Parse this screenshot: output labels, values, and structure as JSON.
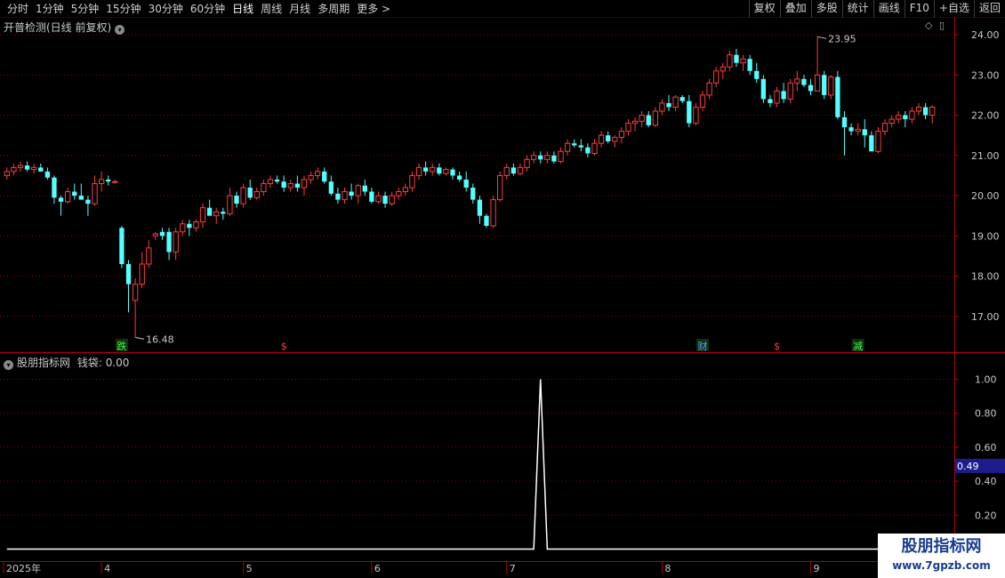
{
  "toolbar": {
    "periods": [
      "分时",
      "1分钟",
      "5分钟",
      "15分钟",
      "30分钟",
      "60分钟",
      "日线",
      "周线",
      "月线",
      "多周期",
      "更多 >"
    ],
    "active_period": "日线",
    "right_buttons": [
      "复权",
      "叠加",
      "多股",
      "统计",
      "画线",
      "F10",
      "+自选",
      "返回"
    ]
  },
  "main_pane": {
    "title": "开普检测(日线 前复权)"
  },
  "indicator_pane": {
    "title": "股朋指标网",
    "series_label": "钱袋: 0.00",
    "cursor_value": "0.49"
  },
  "watermark": {
    "line1": "股朋指标网",
    "line2": "www.7gpzb.com"
  },
  "colors": {
    "up": "#ff3c3c",
    "down": "#54ffff",
    "grid": "#8b0000",
    "axis": "#b00000",
    "bg": "#000000",
    "line": "#ffffff",
    "highlight_box": "#1c1c8c"
  },
  "chart_data": [
    {
      "type": "candlestick",
      "y_ticks": [
        "24.00",
        "23.00",
        "22.00",
        "21.00",
        "20.00",
        "19.00",
        "18.00",
        "17.00"
      ],
      "ylim": [
        16.2,
        24.2
      ],
      "annotations": [
        {
          "text": "23.95",
          "value": 23.95
        },
        {
          "text": "16.48",
          "value": 16.48
        }
      ],
      "markers": [
        {
          "text": "跌",
          "color": "#3cff3c",
          "x_index": 17
        },
        {
          "text": "$",
          "color": "#ff3c3c",
          "x_index": 41
        },
        {
          "text": "财",
          "color": "#4ca0ff",
          "x_index": 103
        },
        {
          "text": "$",
          "color": "#ff3c3c",
          "x_index": 114
        },
        {
          "text": "减",
          "color": "#3cff3c",
          "x_index": 126
        }
      ],
      "x_labels": [
        {
          "text": "2025年",
          "index": 0
        },
        {
          "text": "4",
          "index": 14
        },
        {
          "text": "5",
          "index": 35
        },
        {
          "text": "6",
          "index": 54
        },
        {
          "text": "7",
          "index": 74
        },
        {
          "text": "8",
          "index": 97
        },
        {
          "text": "9",
          "index": 119
        }
      ],
      "ohlc": [
        [
          20.5,
          20.7,
          20.4,
          20.6
        ],
        [
          20.6,
          20.8,
          20.5,
          20.7
        ],
        [
          20.7,
          20.85,
          20.6,
          20.75
        ],
        [
          20.75,
          20.85,
          20.6,
          20.65
        ],
        [
          20.65,
          20.8,
          20.55,
          20.7
        ],
        [
          20.7,
          20.8,
          20.6,
          20.6
        ],
        [
          20.6,
          20.7,
          20.4,
          20.45
        ],
        [
          20.45,
          20.5,
          19.8,
          19.95
        ],
        [
          19.95,
          20.0,
          19.5,
          19.85
        ],
        [
          19.85,
          20.2,
          19.8,
          20.1
        ],
        [
          20.1,
          20.3,
          19.9,
          20.0
        ],
        [
          20.0,
          20.3,
          19.9,
          19.9
        ],
        [
          19.9,
          20.0,
          19.5,
          19.8
        ],
        [
          19.8,
          20.5,
          19.75,
          20.3
        ],
        [
          20.3,
          20.6,
          20.1,
          20.4
        ],
        [
          20.4,
          20.5,
          20.25,
          20.35
        ],
        [
          20.35,
          20.4,
          20.3,
          20.35
        ],
        [
          19.2,
          19.25,
          18.2,
          18.3
        ],
        [
          18.3,
          18.4,
          17.1,
          17.8
        ],
        [
          17.4,
          17.95,
          16.48,
          17.8
        ],
        [
          17.8,
          18.6,
          17.7,
          18.3
        ],
        [
          18.3,
          18.9,
          18.2,
          18.7
        ],
        [
          19.0,
          19.1,
          18.9,
          19.05
        ],
        [
          19.1,
          19.2,
          18.9,
          19.0
        ],
        [
          19.1,
          19.2,
          18.4,
          18.6
        ],
        [
          18.6,
          19.2,
          18.4,
          19.1
        ],
        [
          19.1,
          19.4,
          19.0,
          19.3
        ],
        [
          19.3,
          19.4,
          19.0,
          19.2
        ],
        [
          19.2,
          19.4,
          19.1,
          19.35
        ],
        [
          19.35,
          19.8,
          19.2,
          19.7
        ],
        [
          19.7,
          19.9,
          19.6,
          19.5
        ],
        [
          19.5,
          19.7,
          19.3,
          19.6
        ],
        [
          19.6,
          19.7,
          19.4,
          19.55
        ],
        [
          19.55,
          20.2,
          19.5,
          20.0
        ],
        [
          20.0,
          20.1,
          19.7,
          19.8
        ],
        [
          19.8,
          20.3,
          19.7,
          20.2
        ],
        [
          20.2,
          20.4,
          19.9,
          19.95
        ],
        [
          19.95,
          20.2,
          19.9,
          20.1
        ],
        [
          20.1,
          20.4,
          20.0,
          20.3
        ],
        [
          20.3,
          20.5,
          20.2,
          20.4
        ],
        [
          20.4,
          20.5,
          20.3,
          20.35
        ],
        [
          20.35,
          20.5,
          20.1,
          20.2
        ],
        [
          20.2,
          20.4,
          20.1,
          20.3
        ],
        [
          20.3,
          20.5,
          20.1,
          20.2
        ],
        [
          20.2,
          20.5,
          20.0,
          20.4
        ],
        [
          20.4,
          20.6,
          20.3,
          20.5
        ],
        [
          20.5,
          20.7,
          20.4,
          20.6
        ],
        [
          20.6,
          20.7,
          20.3,
          20.35
        ],
        [
          20.35,
          20.5,
          20.0,
          20.05
        ],
        [
          20.05,
          20.2,
          19.8,
          19.9
        ],
        [
          19.9,
          20.2,
          19.8,
          20.1
        ],
        [
          20.1,
          20.3,
          19.9,
          20.0
        ],
        [
          20.0,
          20.3,
          19.8,
          20.25
        ],
        [
          20.25,
          20.4,
          20.0,
          20.1
        ],
        [
          20.1,
          20.2,
          19.8,
          19.85
        ],
        [
          19.85,
          20.1,
          19.8,
          20.0
        ],
        [
          20.0,
          20.1,
          19.7,
          19.8
        ],
        [
          19.8,
          20.1,
          19.75,
          20.0
        ],
        [
          20.0,
          20.2,
          19.9,
          20.1
        ],
        [
          20.1,
          20.3,
          20.0,
          20.2
        ],
        [
          20.2,
          20.6,
          20.1,
          20.5
        ],
        [
          20.5,
          20.8,
          20.4,
          20.7
        ],
        [
          20.7,
          20.85,
          20.5,
          20.6
        ],
        [
          20.6,
          20.8,
          20.5,
          20.7
        ],
        [
          20.7,
          20.8,
          20.5,
          20.55
        ],
        [
          20.55,
          20.7,
          20.5,
          20.65
        ],
        [
          20.65,
          20.7,
          20.4,
          20.5
        ],
        [
          20.5,
          20.6,
          20.35,
          20.4
        ],
        [
          20.4,
          20.6,
          20.1,
          20.2
        ],
        [
          20.2,
          20.3,
          19.8,
          19.9
        ],
        [
          19.9,
          20.0,
          19.3,
          19.5
        ],
        [
          19.5,
          19.55,
          19.2,
          19.25
        ],
        [
          19.25,
          20.0,
          19.2,
          19.9
        ],
        [
          19.9,
          20.6,
          19.85,
          20.5
        ],
        [
          20.5,
          20.8,
          20.4,
          20.7
        ],
        [
          20.7,
          20.8,
          20.5,
          20.55
        ],
        [
          20.55,
          20.8,
          20.5,
          20.7
        ],
        [
          20.7,
          21.0,
          20.6,
          20.9
        ],
        [
          20.9,
          21.1,
          20.8,
          21.0
        ],
        [
          21.0,
          21.1,
          20.8,
          20.9
        ],
        [
          20.9,
          21.1,
          20.8,
          21.0
        ],
        [
          21.0,
          21.1,
          20.8,
          20.85
        ],
        [
          20.85,
          21.2,
          20.8,
          21.1
        ],
        [
          21.1,
          21.4,
          21.0,
          21.3
        ],
        [
          21.3,
          21.4,
          21.2,
          21.25
        ],
        [
          21.25,
          21.4,
          21.1,
          21.2
        ],
        [
          21.2,
          21.3,
          20.95,
          21.05
        ],
        [
          21.05,
          21.4,
          21.0,
          21.3
        ],
        [
          21.3,
          21.6,
          21.2,
          21.5
        ],
        [
          21.5,
          21.6,
          21.3,
          21.35
        ],
        [
          21.35,
          21.5,
          21.2,
          21.45
        ],
        [
          21.45,
          21.7,
          21.3,
          21.6
        ],
        [
          21.6,
          21.9,
          21.5,
          21.8
        ],
        [
          21.8,
          21.95,
          21.6,
          21.85
        ],
        [
          21.85,
          22.1,
          21.7,
          22.0
        ],
        [
          22.0,
          22.1,
          21.7,
          21.75
        ],
        [
          21.75,
          22.2,
          21.7,
          22.1
        ],
        [
          22.1,
          22.4,
          22.0,
          22.3
        ],
        [
          22.3,
          22.5,
          22.1,
          22.2
        ],
        [
          22.2,
          22.5,
          22.1,
          22.45
        ],
        [
          22.45,
          22.5,
          22.3,
          22.35
        ],
        [
          22.35,
          22.5,
          21.7,
          21.8
        ],
        [
          21.8,
          22.3,
          21.75,
          22.2
        ],
        [
          22.2,
          22.6,
          22.1,
          22.5
        ],
        [
          22.5,
          22.9,
          22.4,
          22.8
        ],
        [
          22.8,
          23.2,
          22.7,
          23.1
        ],
        [
          23.1,
          23.3,
          22.9,
          23.2
        ],
        [
          23.2,
          23.6,
          23.1,
          23.5
        ],
        [
          23.5,
          23.65,
          23.2,
          23.3
        ],
        [
          23.3,
          23.5,
          23.1,
          23.4
        ],
        [
          23.4,
          23.5,
          23.0,
          23.1
        ],
        [
          23.1,
          23.3,
          22.8,
          22.9
        ],
        [
          22.9,
          23.0,
          22.3,
          22.4
        ],
        [
          22.4,
          22.5,
          22.2,
          22.3
        ],
        [
          22.3,
          22.7,
          22.2,
          22.6
        ],
        [
          22.6,
          22.8,
          22.3,
          22.4
        ],
        [
          22.4,
          22.9,
          22.3,
          22.8
        ],
        [
          22.8,
          23.1,
          22.6,
          22.9
        ],
        [
          22.9,
          23.0,
          22.7,
          22.75
        ],
        [
          22.75,
          22.9,
          22.5,
          22.6
        ],
        [
          22.6,
          23.95,
          22.6,
          23.0
        ],
        [
          23.0,
          23.1,
          22.4,
          22.5
        ],
        [
          22.5,
          23.0,
          22.4,
          22.95
        ],
        [
          22.95,
          23.1,
          21.9,
          21.95
        ],
        [
          21.95,
          22.1,
          21.0,
          21.7
        ],
        [
          21.7,
          21.8,
          21.5,
          21.6
        ],
        [
          21.6,
          21.8,
          21.5,
          21.65
        ],
        [
          21.65,
          21.9,
          21.2,
          21.5
        ],
        [
          21.5,
          21.6,
          21.1,
          21.1
        ],
        [
          21.1,
          21.7,
          21.05,
          21.6
        ],
        [
          21.6,
          21.9,
          21.5,
          21.8
        ],
        [
          21.8,
          22.0,
          21.7,
          21.9
        ],
        [
          21.9,
          22.1,
          21.8,
          22.0
        ],
        [
          22.0,
          22.1,
          21.7,
          21.9
        ],
        [
          21.9,
          22.2,
          21.8,
          22.1
        ],
        [
          22.1,
          22.3,
          22.0,
          22.2
        ],
        [
          22.2,
          22.3,
          21.9,
          22.0
        ],
        [
          22.0,
          22.25,
          21.8,
          22.2
        ]
      ]
    },
    {
      "type": "line",
      "name": "钱袋",
      "y_ticks": [
        "1.00",
        "0.80",
        "0.60",
        "0.40",
        "0.20"
      ],
      "ylim": [
        -0.05,
        1.05
      ],
      "spike_index": 79,
      "spike_value": 1.0,
      "count": 131
    }
  ]
}
